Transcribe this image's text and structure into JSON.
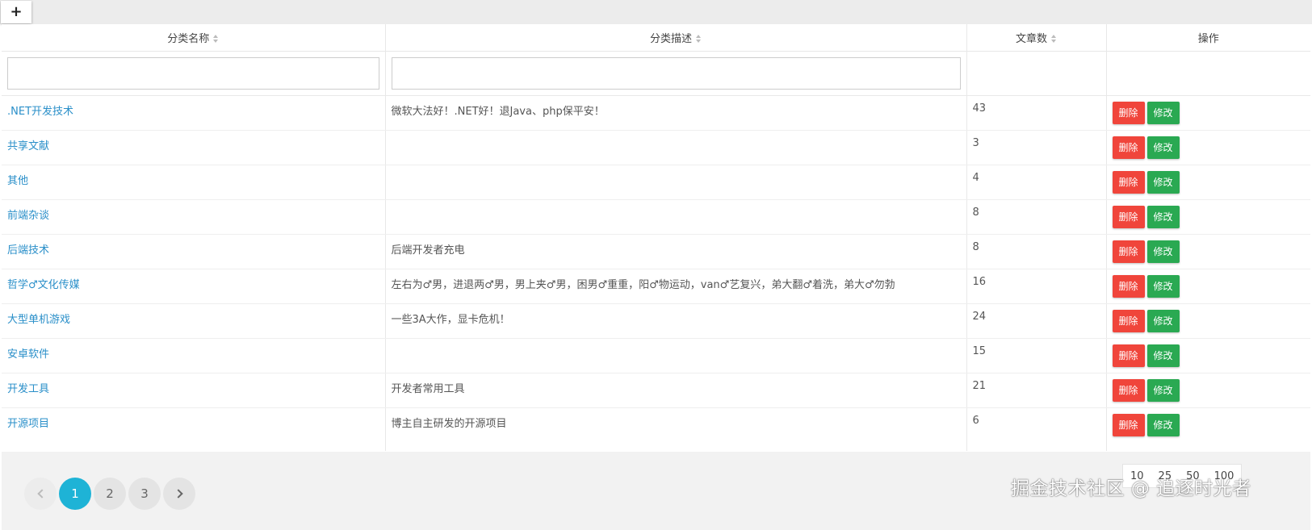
{
  "toolbar": {
    "add_label": "+"
  },
  "columns": [
    "分类名称",
    "分类描述",
    "文章数",
    "操作"
  ],
  "filters": {
    "name_value": "",
    "desc_value": ""
  },
  "rows": [
    {
      "name": ".NET开发技术",
      "desc": "微软大法好！.NET好！退Java、php保平安！",
      "count": "43"
    },
    {
      "name": "共享文献",
      "desc": "",
      "count": "3"
    },
    {
      "name": "其他",
      "desc": "",
      "count": "4"
    },
    {
      "name": "前端杂谈",
      "desc": "",
      "count": "8"
    },
    {
      "name": "后端技术",
      "desc": "后端开发者充电",
      "count": "8"
    },
    {
      "name": "哲学♂文化传媒",
      "desc": "左右为♂男，进退两♂男，男上夹♂男，困男♂重重，阳♂物运动，van♂艺复兴，弟大翻♂着洗，弟大♂勿勃",
      "count": "16"
    },
    {
      "name": "大型单机游戏",
      "desc": "一些3A大作，显卡危机！",
      "count": "24"
    },
    {
      "name": "安卓软件",
      "desc": "",
      "count": "15"
    },
    {
      "name": "开发工具",
      "desc": "开发者常用工具",
      "count": "21"
    },
    {
      "name": "开源项目",
      "desc": "博主自主研发的开源项目",
      "count": "6"
    }
  ],
  "actions": {
    "delete_label": "删除",
    "edit_label": "修改"
  },
  "pagination": {
    "pages": [
      "1",
      "2",
      "3"
    ],
    "current": "1"
  },
  "page_sizes": [
    "10",
    "25",
    "50",
    "100"
  ],
  "watermark": "掘金技术社区 @ 追逐时光者",
  "colors": {
    "link": "#2a8fc9",
    "delete": "#f0453b",
    "edit": "#2aa952",
    "active_page": "#1eb3d6"
  }
}
